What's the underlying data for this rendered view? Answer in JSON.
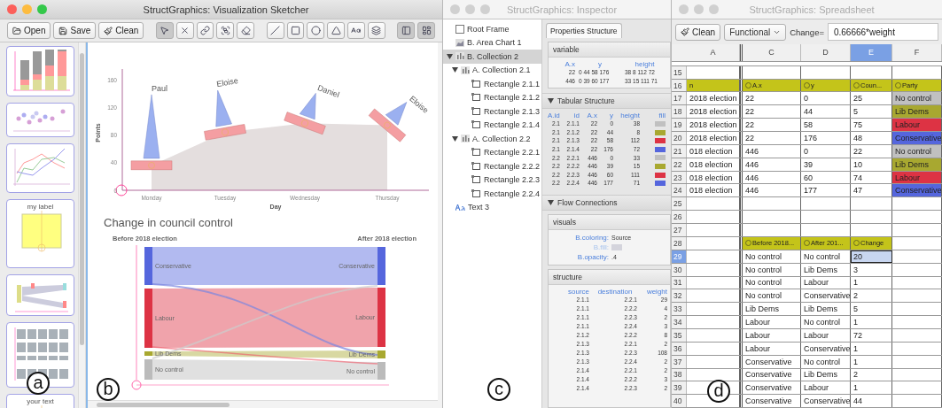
{
  "sketcher": {
    "title": "StructGraphics: Visualization Sketcher",
    "active": true,
    "buttons": [
      {
        "label": "Open"
      },
      {
        "label": "Save"
      },
      {
        "label": "Clean"
      }
    ],
    "tools": [
      {
        "kind": "select",
        "selected": true
      },
      {
        "kind": "delete",
        "selected": false
      },
      {
        "kind": "link",
        "selected": false
      },
      {
        "kind": "group",
        "selected": false
      },
      {
        "kind": "eraser",
        "selected": false
      },
      {
        "kind": "line",
        "selected": false
      },
      {
        "kind": "rect",
        "selected": false
      },
      {
        "kind": "ellipse",
        "selected": false
      },
      {
        "kind": "triangle",
        "selected": false
      },
      {
        "kind": "text",
        "selected": false
      },
      {
        "kind": "stack",
        "selected": false
      },
      {
        "kind": "axis",
        "selected": true
      },
      {
        "kind": "frame",
        "selected": true
      }
    ],
    "thumbnails": [
      {
        "kind": "bars"
      },
      {
        "kind": "scatter"
      },
      {
        "kind": "lines"
      },
      {
        "kind": "label",
        "text": "my label"
      },
      {
        "kind": "flow"
      },
      {
        "kind": "grid"
      },
      {
        "kind": "label",
        "text": "your text"
      }
    ],
    "sidebar_marker": "a",
    "canvas_marker": "b",
    "area_chart": {
      "xlabel": "Day",
      "ylabel": "Points",
      "y_ticks": [
        "160",
        "120",
        "80",
        "40",
        "0"
      ],
      "days": [
        "Monday",
        "Tuesday",
        "Wednesday",
        "Thursday"
      ],
      "boats": [
        {
          "label": "Paul"
        },
        {
          "label": "Eloise"
        },
        {
          "label": "Daniel"
        },
        {
          "label": "Eloise"
        }
      ]
    },
    "sankey": {
      "title": "Change in council control",
      "left_heading": "Before 2018 election",
      "right_heading": "After 2018 election",
      "left_nodes": [
        {
          "label": "Conservative",
          "color": "#5566dd"
        },
        {
          "label": "Labour",
          "color": "#dd3344"
        },
        {
          "label": "Lib Dems",
          "color": "#a8a830"
        },
        {
          "label": "No control",
          "color": "#bbbbbb"
        }
      ],
      "right_nodes": [
        {
          "label": "Conservative",
          "color": "#5566dd"
        },
        {
          "label": "Labour",
          "color": "#dd3344"
        },
        {
          "label": "Lib Dems",
          "color": "#a8a830"
        },
        {
          "label": "No control",
          "color": "#bbbbbb"
        }
      ]
    }
  },
  "inspector": {
    "title": "StructGraphics: Inspector",
    "active": false,
    "marker": "c",
    "tree": [
      {
        "label": "Root Frame",
        "kind": "frame",
        "selected": false,
        "children": [
          {
            "label": "B. Area Chart 1",
            "kind": "area",
            "selected": false
          },
          {
            "label": "B. Collection 2",
            "kind": "collection",
            "selected": true,
            "expanded": true,
            "children": [
              {
                "label": "A. Collection 2.1",
                "kind": "collection",
                "selected": false,
                "expanded": true,
                "children": [
                  {
                    "label": "Rectangle 2.1.1",
                    "kind": "rect",
                    "selected": false
                  },
                  {
                    "label": "Rectangle 2.1.2",
                    "kind": "rect",
                    "selected": false
                  },
                  {
                    "label": "Rectangle 2.1.3",
                    "kind": "rect",
                    "selected": false
                  },
                  {
                    "label": "Rectangle 2.1.4",
                    "kind": "rect",
                    "selected": false
                  }
                ]
              },
              {
                "label": "A. Collection 2.2",
                "kind": "collection",
                "selected": false,
                "expanded": true,
                "children": [
                  {
                    "label": "Rectangle 2.2.1",
                    "kind": "rect",
                    "selected": false
                  },
                  {
                    "label": "Rectangle 2.2.2",
                    "kind": "rect",
                    "selected": false
                  },
                  {
                    "label": "Rectangle 2.2.3",
                    "kind": "rect",
                    "selected": false
                  },
                  {
                    "label": "Rectangle 2.2.4",
                    "kind": "rect",
                    "selected": false
                  }
                ]
              }
            ]
          },
          {
            "label": "Text 3",
            "kind": "text",
            "selected": false
          }
        ]
      }
    ],
    "tab": {
      "label": "Properties Structure",
      "selected": true
    },
    "variable": {
      "title": "variable",
      "columns": [
        "A.x",
        "y",
        "height"
      ],
      "rows": [
        [
          "22",
          "0 44 58 176",
          "38 8 112 72"
        ],
        [
          "446",
          "0 39 60 177",
          "33 15 111 71"
        ]
      ]
    },
    "tabular": {
      "title": "Tabular Structure",
      "expanded": true,
      "columns": [
        "A.id",
        "id",
        "A.x",
        "y",
        "height",
        "fill"
      ],
      "rows": [
        {
          "cells": [
            "2.1",
            "2.1.1",
            "22",
            "0",
            "38"
          ],
          "color": "#c0c0c0"
        },
        {
          "cells": [
            "2.1",
            "2.1.2",
            "22",
            "44",
            "8"
          ],
          "color": "#a8a830"
        },
        {
          "cells": [
            "2.1",
            "2.1.3",
            "22",
            "58",
            "112"
          ],
          "color": "#dd3344"
        },
        {
          "cells": [
            "2.1",
            "2.1.4",
            "22",
            "176",
            "72"
          ],
          "color": "#5566dd"
        },
        {
          "cells": [
            "2.2",
            "2.2.1",
            "446",
            "0",
            "33"
          ],
          "color": "#c0c0c0"
        },
        {
          "cells": [
            "2.2",
            "2.2.2",
            "446",
            "39",
            "15"
          ],
          "color": "#a8a830"
        },
        {
          "cells": [
            "2.2",
            "2.2.3",
            "446",
            "60",
            "111"
          ],
          "color": "#dd3344"
        },
        {
          "cells": [
            "2.2",
            "2.2.4",
            "446",
            "177",
            "71"
          ],
          "color": "#5566dd"
        }
      ]
    },
    "flow": {
      "title": "Flow Connections",
      "expanded": true,
      "visuals": {
        "title": "visuals",
        "props": [
          {
            "label": "B.coloring:",
            "kind": "text",
            "value": "Source",
            "disabled": false
          },
          {
            "label": "B.fill:",
            "kind": "swatch",
            "color": "#d4d4dc",
            "disabled": true
          },
          {
            "label": "B.opacity:",
            "kind": "text",
            "value": ".4",
            "disabled": false
          }
        ]
      },
      "structure": {
        "title": "structure",
        "columns": [
          "source",
          "destination",
          "weight"
        ],
        "rows": [
          [
            "2.1.1",
            "2.2.1",
            "29"
          ],
          [
            "2.1.1",
            "2.2.2",
            "4"
          ],
          [
            "2.1.1",
            "2.2.3",
            "2"
          ],
          [
            "2.1.1",
            "2.2.4",
            "3"
          ],
          [
            "2.1.2",
            "2.2.2",
            "8"
          ],
          [
            "2.1.3",
            "2.2.1",
            "2"
          ],
          [
            "2.1.3",
            "2.2.3",
            "108"
          ],
          [
            "2.1.3",
            "2.2.4",
            "2"
          ],
          [
            "2.1.4",
            "2.2.1",
            "2"
          ],
          [
            "2.1.4",
            "2.2.2",
            "3"
          ],
          [
            "2.1.4",
            "2.2.3",
            "2"
          ]
        ]
      }
    }
  },
  "spreadsheet": {
    "title": "StructGraphics: Spreadsheet",
    "active": false,
    "marker": "d",
    "clean_button": "Clean",
    "mode": "Functional",
    "formula_label": "Change=",
    "formula": "0.66666*weight",
    "columns": [
      {
        "label": "A",
        "selected": false
      },
      {
        "label": "C",
        "selected": false
      },
      {
        "label": "D",
        "selected": false
      },
      {
        "label": "E",
        "selected": true
      },
      {
        "label": "F",
        "selected": false
      }
    ],
    "rows": [
      {
        "number": "15",
        "kind": "data",
        "selected": false
      },
      {
        "number": "16",
        "kind": "header",
        "selected": false,
        "cells": [
          "n",
          "A.x",
          "y",
          "Coun...",
          "Party"
        ]
      },
      {
        "number": "17",
        "kind": "data",
        "selected": false,
        "cells": [
          "2018 election",
          "22",
          "0",
          "25",
          "No control"
        ],
        "color": "#c0c0c0"
      },
      {
        "number": "18",
        "kind": "data",
        "selected": false,
        "cells": [
          "2018 election",
          "22",
          "44",
          "5",
          "Lib Dems"
        ],
        "color": "#a8a830"
      },
      {
        "number": "19",
        "kind": "data",
        "selected": false,
        "cells": [
          "2018 election",
          "22",
          "58",
          "75",
          "Labour"
        ],
        "color": "#dd3344"
      },
      {
        "number": "20",
        "kind": "data",
        "selected": false,
        "cells": [
          "2018 election",
          "22",
          "176",
          "48",
          "Conservative"
        ],
        "color": "#5566dd"
      },
      {
        "number": "21",
        "kind": "data",
        "selected": false,
        "cells": [
          "018 election",
          "446",
          "0",
          "22",
          "No control"
        ],
        "color": "#c0c0c0"
      },
      {
        "number": "22",
        "kind": "data",
        "selected": false,
        "cells": [
          "018 election",
          "446",
          "39",
          "10",
          "Lib Dems"
        ],
        "color": "#a8a830"
      },
      {
        "number": "23",
        "kind": "data",
        "selected": false,
        "cells": [
          "018 election",
          "446",
          "60",
          "74",
          "Labour"
        ],
        "color": "#dd3344"
      },
      {
        "number": "24",
        "kind": "data",
        "selected": false,
        "cells": [
          "018 election",
          "446",
          "177",
          "47",
          "Conservative"
        ],
        "color": "#5566dd"
      },
      {
        "number": "25",
        "kind": "data",
        "selected": false
      },
      {
        "number": "26",
        "kind": "data",
        "selected": false
      },
      {
        "number": "27",
        "kind": "data",
        "selected": false
      },
      {
        "number": "28",
        "kind": "header",
        "selected": false,
        "cells": [
          null,
          "Before 2018...",
          "After 201...",
          "Change",
          null
        ]
      },
      {
        "number": "29",
        "kind": "data",
        "selected": true,
        "cells": [
          null,
          "No control",
          "No control",
          "20",
          null
        ]
      },
      {
        "number": "30",
        "kind": "data",
        "selected": false,
        "cells": [
          null,
          "No control",
          "Lib Dems",
          "3",
          null
        ]
      },
      {
        "number": "31",
        "kind": "data",
        "selected": false,
        "cells": [
          null,
          "No control",
          "Labour",
          "1",
          null
        ]
      },
      {
        "number": "32",
        "kind": "data",
        "selected": false,
        "cells": [
          null,
          "No control",
          "Conservative",
          "2",
          null
        ]
      },
      {
        "number": "33",
        "kind": "data",
        "selected": false,
        "cells": [
          null,
          "Lib Dems",
          "Lib Dems",
          "5",
          null
        ]
      },
      {
        "number": "34",
        "kind": "data",
        "selected": false,
        "cells": [
          null,
          "Labour",
          "No control",
          "1",
          null
        ]
      },
      {
        "number": "35",
        "kind": "data",
        "selected": false,
        "cells": [
          null,
          "Labour",
          "Labour",
          "72",
          null
        ]
      },
      {
        "number": "36",
        "kind": "data",
        "selected": false,
        "cells": [
          null,
          "Labour",
          "Conservative",
          "1",
          null
        ]
      },
      {
        "number": "37",
        "kind": "data",
        "selected": false,
        "cells": [
          null,
          "Conservative",
          "No control",
          "1",
          null
        ]
      },
      {
        "number": "38",
        "kind": "data",
        "selected": false,
        "cells": [
          null,
          "Conservative",
          "Lib Dems",
          "2",
          null
        ]
      },
      {
        "number": "39",
        "kind": "data",
        "selected": false,
        "cells": [
          null,
          "Conservative",
          "Labour",
          "1",
          null
        ]
      },
      {
        "number": "40",
        "kind": "data",
        "selected": false,
        "cells": [
          null,
          "Conservative",
          "Conservative",
          "44",
          null
        ]
      }
    ]
  }
}
